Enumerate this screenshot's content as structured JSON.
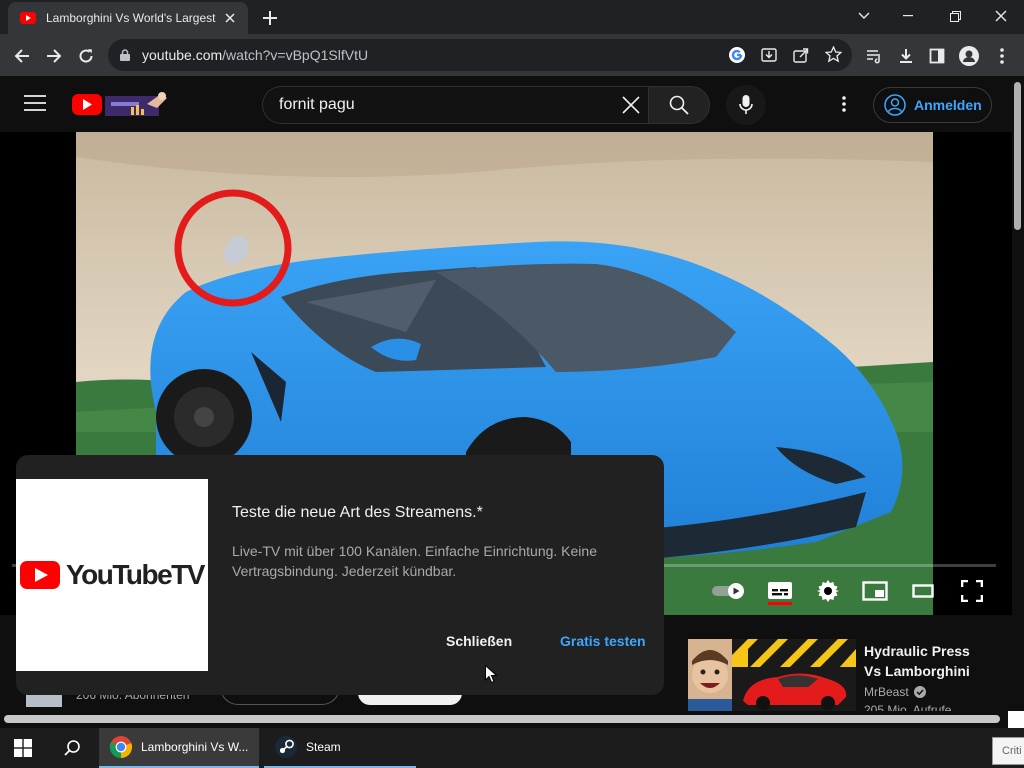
{
  "browser": {
    "tab_title": "Lamborghini Vs World's Largest",
    "url_host": "youtube.com",
    "url_path": "/watch?v=vBpQ1SlfVtU"
  },
  "youtube": {
    "search_query": "fornit pagu",
    "signin_label": "Anmelden"
  },
  "below_video": {
    "subscribers_text": "206 Mio. Abonnenten"
  },
  "player": {
    "progress_fraction": 0.0
  },
  "promo": {
    "logo_text": "YouTubeTV",
    "heading": "Teste die neue Art des Streamens.*",
    "body": "Live-TV mit über 100 Kanälen. Einfache Einrichtung. Keine Vertragsbindung. Jederzeit kündbar.",
    "close_label": "Schließen",
    "cta_label": "Gratis testen"
  },
  "recommendation": {
    "title_line1": "Hydraulic Press",
    "title_line2": "Vs Lamborghini",
    "channel": "MrBeast",
    "views": "205 Mio. Aufrufe"
  },
  "taskbar": {
    "chrome_label": "Lamborghini Vs W...",
    "steam_label": "Steam",
    "corner_text": "Criti"
  },
  "colors": {
    "youtube_red": "#ff0000",
    "link_blue": "#3ea6ff",
    "car_blue": "#2f97ee"
  }
}
